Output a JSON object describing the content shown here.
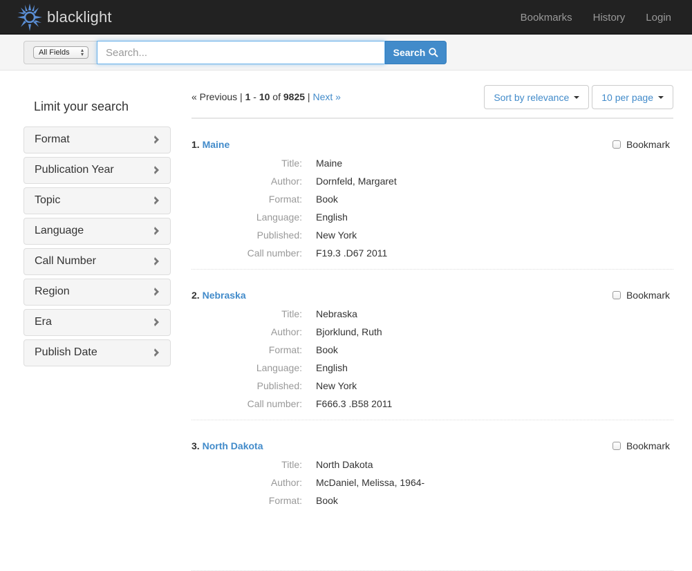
{
  "navbar": {
    "brand": "blacklight",
    "links": [
      "Bookmarks",
      "History",
      "Login"
    ]
  },
  "search": {
    "field_selected": "All Fields",
    "placeholder": "Search...",
    "value": "",
    "button_label": "Search"
  },
  "sidebar": {
    "heading": "Limit your search",
    "facets": [
      "Format",
      "Publication Year",
      "Topic",
      "Language",
      "Call Number",
      "Region",
      "Era",
      "Publish Date"
    ]
  },
  "results": {
    "pager": {
      "previous": "« Previous",
      "separator": "|",
      "range_start": "1",
      "range_end": "10",
      "of": "of",
      "total": "9825",
      "next": "Next »"
    },
    "sort_label": "Sort by relevance",
    "per_page_label": "10 per page",
    "bookmark_label": "Bookmark",
    "documents": [
      {
        "index": "1.",
        "title": "Maine",
        "fields": [
          {
            "label": "Title:",
            "value": "Maine"
          },
          {
            "label": "Author:",
            "value": "Dornfeld, Margaret"
          },
          {
            "label": "Format:",
            "value": "Book"
          },
          {
            "label": "Language:",
            "value": "English"
          },
          {
            "label": "Published:",
            "value": "New York"
          },
          {
            "label": "Call number:",
            "value": "F19.3 .D67 2011"
          }
        ]
      },
      {
        "index": "2.",
        "title": "Nebraska",
        "fields": [
          {
            "label": "Title:",
            "value": "Nebraska"
          },
          {
            "label": "Author:",
            "value": "Bjorklund, Ruth"
          },
          {
            "label": "Format:",
            "value": "Book"
          },
          {
            "label": "Language:",
            "value": "English"
          },
          {
            "label": "Published:",
            "value": "New York"
          },
          {
            "label": "Call number:",
            "value": "F666.3 .B58 2011"
          }
        ]
      },
      {
        "index": "3.",
        "title": "North Dakota",
        "fields": [
          {
            "label": "Title:",
            "value": "North Dakota"
          },
          {
            "label": "Author:",
            "value": "McDaniel, Melissa, 1964-"
          },
          {
            "label": "Format:",
            "value": "Book"
          }
        ]
      }
    ]
  },
  "colors": {
    "navbar_bg": "#222222",
    "link": "#428bca",
    "label_gray": "#999999"
  }
}
